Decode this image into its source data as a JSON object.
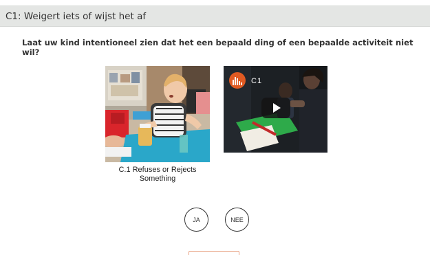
{
  "section": {
    "title": "C1: Weigert iets of wijst het af"
  },
  "question": {
    "text": "Laat uw kind intentioneel zien dat het een bepaald ding of een bepaalde activiteit niet wil?"
  },
  "example_card": {
    "caption": "C.1 Refuses or Rejects Something"
  },
  "video": {
    "title": "C1",
    "icon": "play-icon"
  },
  "answers": {
    "yes_label": "JA",
    "no_label": "NEE"
  },
  "colors": {
    "header_bg": "#e4e6e4",
    "logo_orange": "#e05a22",
    "button_border": "#333333",
    "next_border": "#e8a080"
  }
}
